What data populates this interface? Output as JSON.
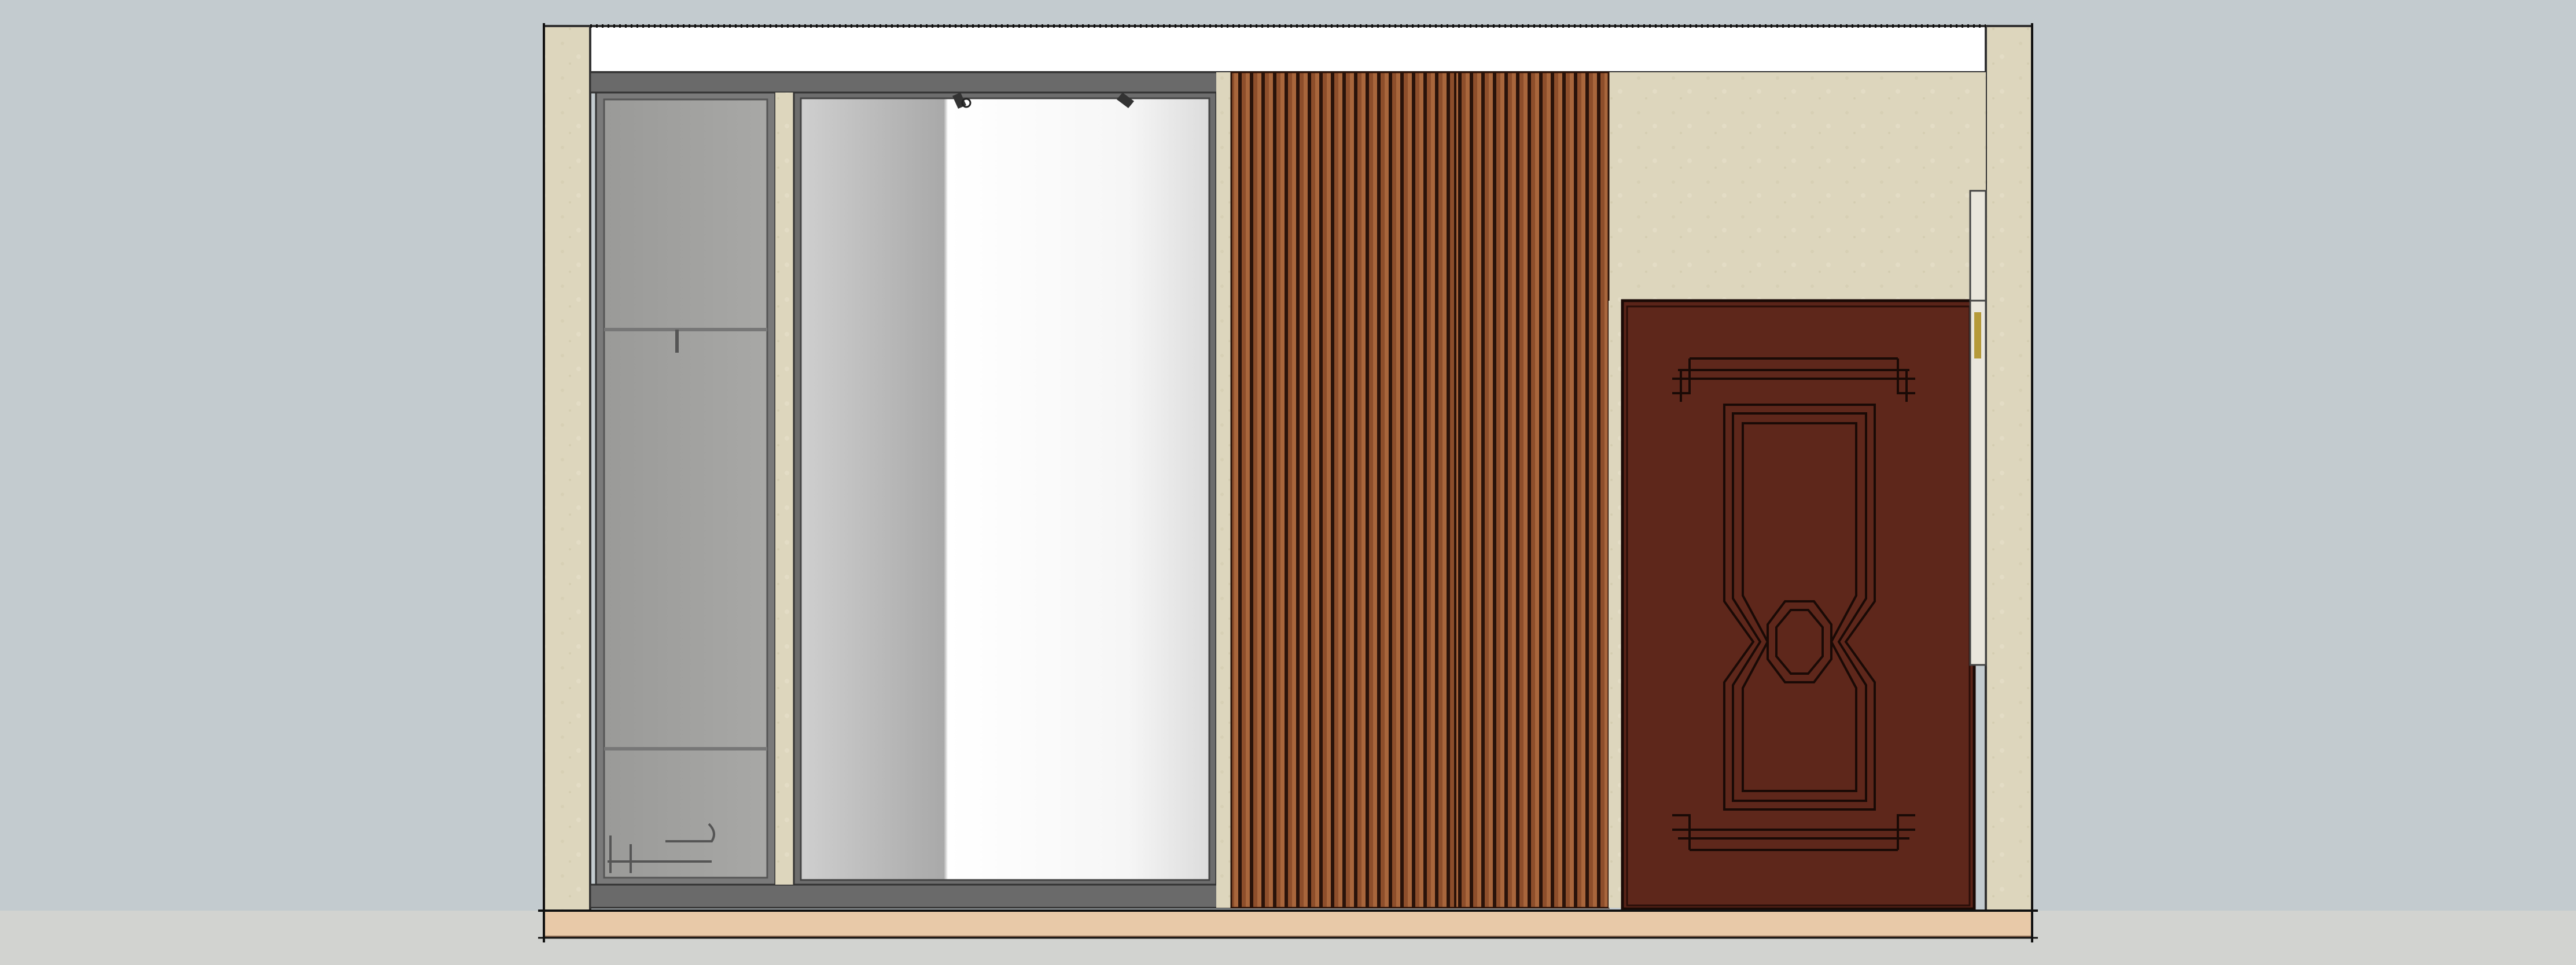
{
  "view": {
    "type": "interior elevation",
    "elements": [
      "stone-wall-left",
      "wardrobe-glass-panel",
      "mirror-sliding-door",
      "wood-slat-wall-panel",
      "stone-wall-right",
      "wooden-door",
      "floor-strip",
      "ceiling-band"
    ]
  },
  "colors": {
    "background": "#c3cbcf",
    "stone": "#ded7bf",
    "glass_frame": "#6a6a6a",
    "glass_fill": "#a4a4a2",
    "mirror_gray": "#b6b6b6",
    "mirror_white": "#ffffff",
    "slat_dark": "#4a2515",
    "slat_light": "#a85f36",
    "door_wood": "#5a2419",
    "door_line": "#1a0a06",
    "floor": "#e8c9a8",
    "ceiling": "#ffffff"
  }
}
